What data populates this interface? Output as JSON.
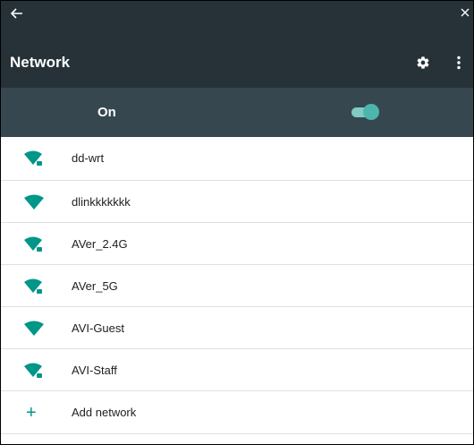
{
  "appbar": {
    "title": "Network",
    "icons": [
      "back-arrow-icon",
      "close-icon",
      "gear-icon",
      "more-vert-icon"
    ]
  },
  "wifi_switch": {
    "label": "On",
    "state": "on"
  },
  "networks": [
    {
      "ssid": "dd-wrt",
      "secured": true
    },
    {
      "ssid": "dlinkkkkkkk",
      "secured": false
    },
    {
      "ssid": "AVer_2.4G",
      "secured": true
    },
    {
      "ssid": "AVer_5G",
      "secured": true
    },
    {
      "ssid": "AVI-Guest",
      "secured": false
    },
    {
      "ssid": "AVI-Staff",
      "secured": true
    }
  ],
  "add_network": {
    "label": "Add network",
    "icon": "plus-icon"
  },
  "colors": {
    "appbar": "#263238",
    "switchbar": "#37474f",
    "accent": "#009688",
    "toggle_track": "#80cbc4",
    "toggle_thumb": "#4db6ac"
  }
}
